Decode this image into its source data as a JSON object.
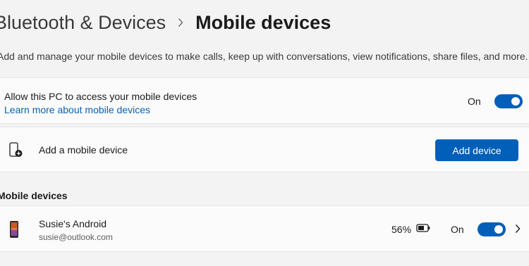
{
  "header": {
    "parent": "Bluetooth & Devices",
    "current": "Mobile devices",
    "description": "Add and manage your mobile devices to make calls, keep up with conversations, view notifications, share files, and more."
  },
  "allow_access": {
    "title": "Allow this PC to access your mobile devices",
    "link": "Learn more about mobile devices",
    "toggle_label": "On",
    "toggle_on": true
  },
  "add_device": {
    "label": "Add a mobile device",
    "button": "Add device"
  },
  "devices_section": {
    "heading": "Mobile devices",
    "devices": [
      {
        "name": "Susie's Android",
        "email": "susie@outlook.com",
        "battery": "56%",
        "toggle_label": "On",
        "toggle_on": true
      }
    ]
  },
  "colors": {
    "accent": "#005fb8",
    "link": "#0a5fb4",
    "background": "#f3f3f3",
    "card": "#fbfbfb"
  },
  "icons": {
    "breadcrumb_separator": "chevron-right-icon",
    "add_device": "phone-add-icon",
    "device": "phone-icon",
    "battery": "battery-icon",
    "device_expand": "chevron-right-icon"
  }
}
